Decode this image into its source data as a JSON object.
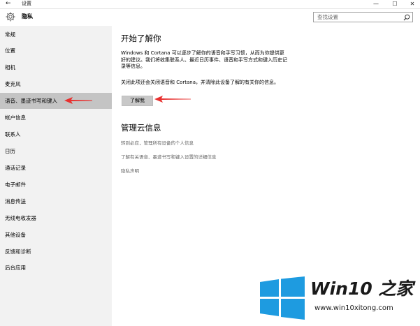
{
  "window": {
    "back_glyph": "←",
    "app_title": "设置",
    "minimize_glyph": "—",
    "maximize_glyph": "☐",
    "close_glyph": "✕"
  },
  "header": {
    "icon": "gear-icon",
    "title": "隐私",
    "search_placeholder": "查找设置",
    "search_icon": "search-icon"
  },
  "sidebar": {
    "items": [
      {
        "label": "常规",
        "active": false
      },
      {
        "label": "位置",
        "active": false
      },
      {
        "label": "相机",
        "active": false
      },
      {
        "label": "麦克风",
        "active": false
      },
      {
        "label": "语音、墨迹书写和键入",
        "active": true
      },
      {
        "label": "帐户信息",
        "active": false
      },
      {
        "label": "联系人",
        "active": false
      },
      {
        "label": "日历",
        "active": false
      },
      {
        "label": "通话记录",
        "active": false
      },
      {
        "label": "电子邮件",
        "active": false
      },
      {
        "label": "消息传送",
        "active": false
      },
      {
        "label": "无线电收发器",
        "active": false
      },
      {
        "label": "其他设备",
        "active": false
      },
      {
        "label": "反馈和诊断",
        "active": false
      },
      {
        "label": "后台应用",
        "active": false
      }
    ]
  },
  "main": {
    "section1_title": "开始了解你",
    "section1_text": "Windows 和 Cortana 可以逐步了解你的语音和手写习惯，从而为你提供更好的建议。我们将收集联系人、最近日历事件、语音和手写方式和键入历史记录等信息。",
    "section1_text2": "关闭此项还会关闭语音和 Cortana，并清除此设备了解的有关你的信息。",
    "learn_button": "了解我",
    "section2_title": "管理云信息",
    "link1": "转到必应，管理所有设备的个人信息",
    "link2": "了解有关语音、墨迹书写和键入设置的详细信息",
    "link3": "隐私声明"
  },
  "colors": {
    "sidebar_bg": "#f2f2f2",
    "active_item_bg": "#c4c4c4",
    "button_bg": "#c8c8c8",
    "annotation_arrow": "#e8302f",
    "logo_blue": "#1e9be0"
  },
  "watermark": {
    "brand": "Win10 之家",
    "url": "www.win10xitong.com"
  }
}
